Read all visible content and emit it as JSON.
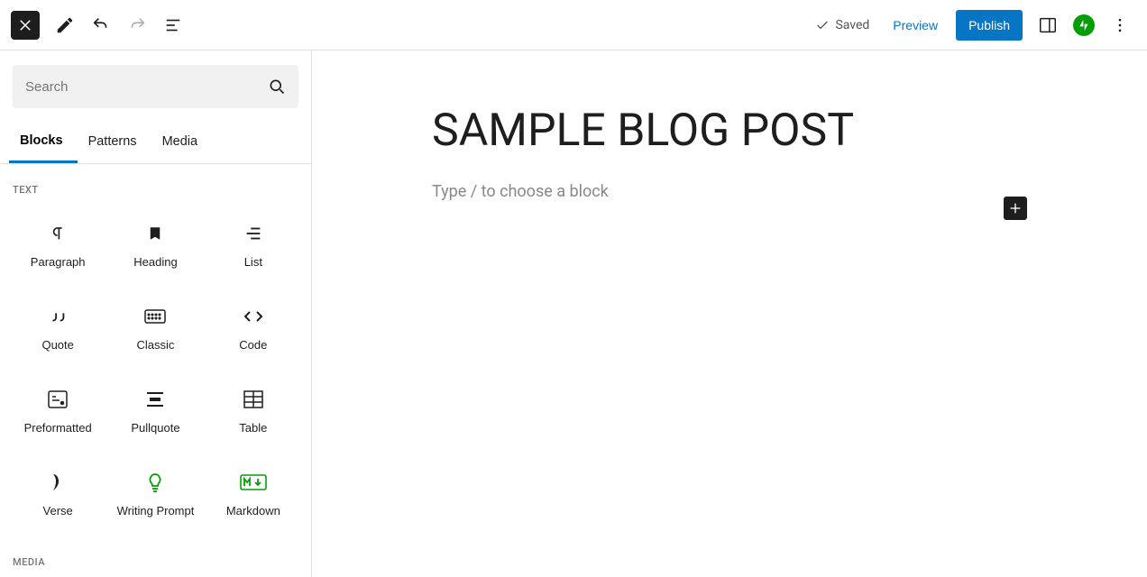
{
  "toolbar": {
    "saved_label": "Saved",
    "preview_label": "Preview",
    "publish_label": "Publish"
  },
  "sidebar": {
    "search_placeholder": "Search",
    "tabs": {
      "blocks": "Blocks",
      "patterns": "Patterns",
      "media": "Media"
    },
    "section_text": "TEXT",
    "section_media": "MEDIA",
    "blocks": {
      "paragraph": "Paragraph",
      "heading": "Heading",
      "list": "List",
      "quote": "Quote",
      "classic": "Classic",
      "code": "Code",
      "preformatted": "Preformatted",
      "pullquote": "Pullquote",
      "table": "Table",
      "verse": "Verse",
      "writing_prompt": "Writing Prompt",
      "markdown": "Markdown"
    }
  },
  "canvas": {
    "title": "SAMPLE BLOG POST",
    "placeholder": "Type / to choose a block"
  }
}
